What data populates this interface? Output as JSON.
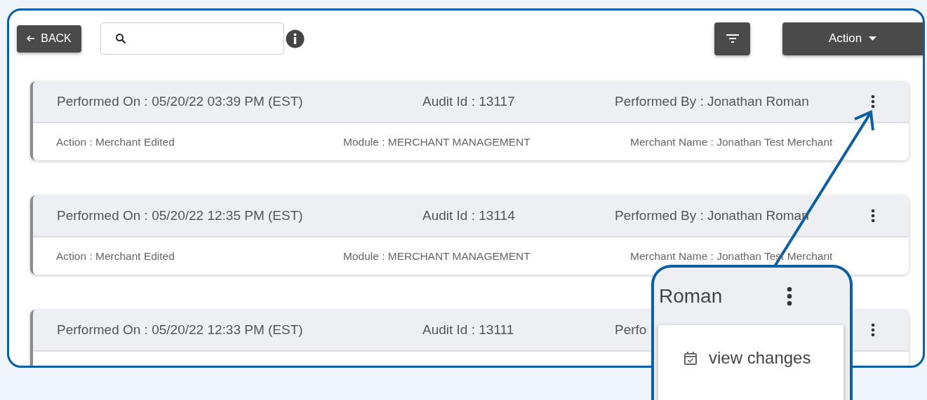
{
  "toolbar": {
    "back_button": "BACK",
    "action_button": "Action"
  },
  "audit_entries": [
    {
      "performed_on": "Performed On : 05/20/22 03:39 PM (EST)",
      "audit_id": "Audit Id : 13117",
      "performed_by": "Performed By : Jonathan Roman",
      "action": "Action : Merchant Edited",
      "module": "Module : MERCHANT MANAGEMENT",
      "merchant_name": "Merchant Name : Jonathan Test Merchant"
    },
    {
      "performed_on": "Performed On : 05/20/22 12:35 PM (EST)",
      "audit_id": "Audit Id : 13114",
      "performed_by": "Performed By : Jonathan Roman",
      "action": "Action : Merchant Edited",
      "module": "Module : MERCHANT MANAGEMENT",
      "merchant_name": "Merchant Name : Jonathan Test Merchant"
    },
    {
      "performed_on": "Performed On : 05/20/22 12:33 PM (EST)",
      "audit_id": "Audit Id : 13111",
      "performed_by": "Perfo"
    }
  ],
  "callout": {
    "header_text": "Roman",
    "menu_items": [
      {
        "label": "view changes"
      }
    ]
  }
}
